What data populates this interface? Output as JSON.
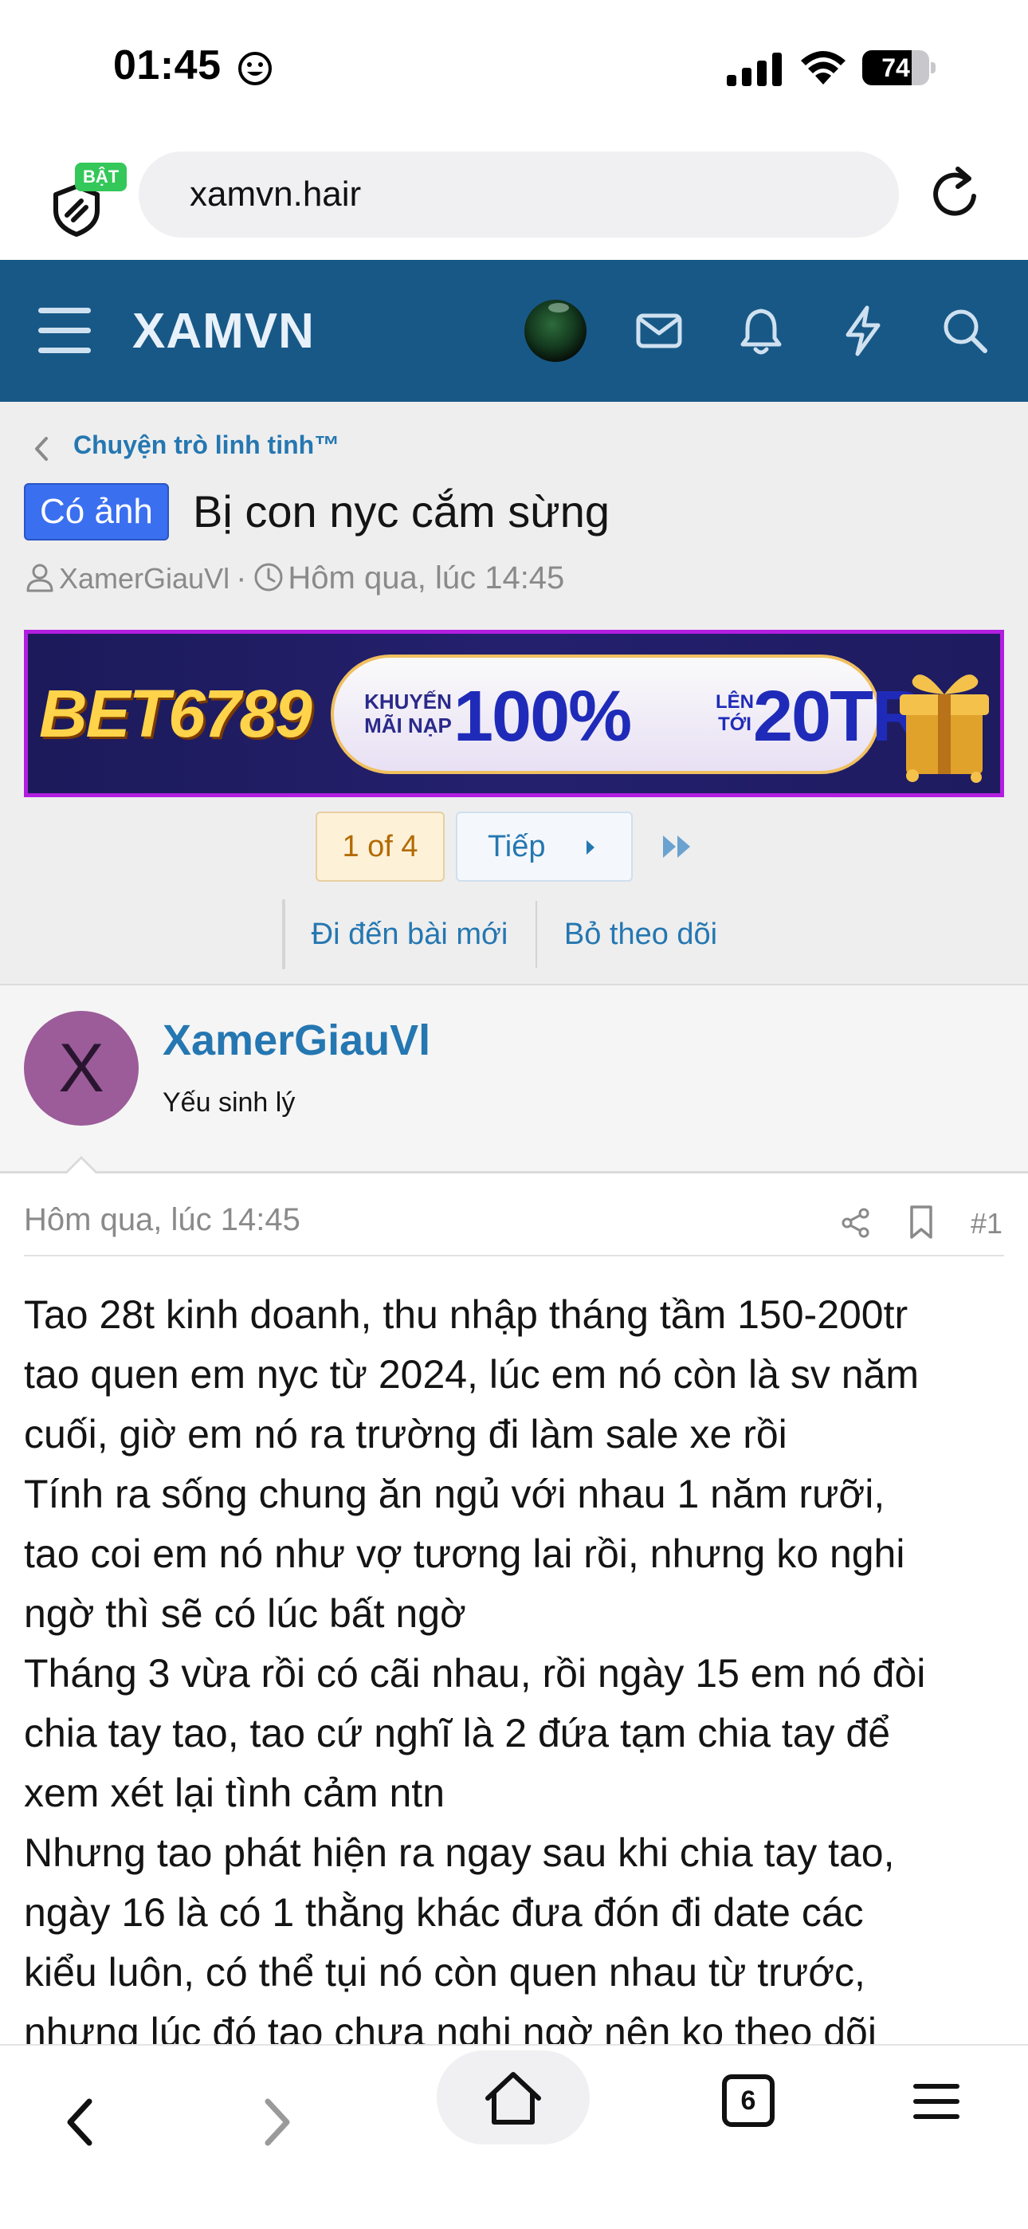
{
  "status_bar": {
    "time": "01:45",
    "battery": "74",
    "battery_level": 0.74
  },
  "browser": {
    "shield_badge": "BẬT",
    "url": "xamvn.hair"
  },
  "site_header": {
    "logo": "XAMVN",
    "icons": [
      "menu-icon",
      "avatar",
      "mail-icon",
      "bell-icon",
      "lightning-icon",
      "search-icon"
    ],
    "colors": {
      "header_bg": "#185886",
      "link": "#2577b1"
    }
  },
  "thread": {
    "breadcrumb": "Chuyện trò linh tinh™",
    "prefix": "Có ảnh",
    "title": "Bị con nyc cắm sừng",
    "author": "XamerGiauVl",
    "separator": "·",
    "date": "Hôm qua, lúc 14:45"
  },
  "banner": {
    "logo": "BET6789",
    "promo_small_1": "KHUYẾN MÃI NẠP",
    "promo_big_1": "100%",
    "promo_small_2": "LÊN TỚI",
    "promo_big_2": "20TR"
  },
  "pagination": {
    "current": "1 of 4",
    "next_label": "Tiếp"
  },
  "thread_actions": {
    "goto_new": "Đi đến bài mới",
    "unwatch": "Bỏ theo dõi"
  },
  "post": {
    "avatar_letter": "X",
    "username": "XamerGiauVl",
    "user_title": "Yếu sinh lý",
    "date": "Hôm qua, lúc 14:45",
    "number": "#1",
    "lines": [
      "Tao 28t kinh doanh, thu nhập tháng tầm 150-200tr",
      "tao quen em nyc từ 2024, lúc em nó còn là sv năm",
      "cuối, giờ em nó ra trường đi làm sale xe rồi",
      "Tính ra sống chung ăn ngủ với nhau 1 năm rưỡi,",
      "tao coi em nó như vợ tương lai rồi, nhưng ko nghi",
      "ngờ thì sẽ có lúc bất ngờ",
      "Tháng 3 vừa rồi có cãi nhau, rồi ngày 15 em nó đòi",
      "chia tay tao, tao cứ nghĩ là 2 đứa tạm chia tay để",
      "xem xét lại tình cảm ntn",
      "Nhưng tao phát hiện ra ngay sau khi chia tay tao,",
      "ngày 16 là có 1 thằng khác đưa đón đi date các",
      "kiểu luôn, có thể tụi nó còn quen nhau từ trước,",
      "nhưng lúc đó tao chưa nghi ngờ nên ko theo dõi"
    ]
  },
  "toolbar": {
    "tabs_count": "6"
  }
}
